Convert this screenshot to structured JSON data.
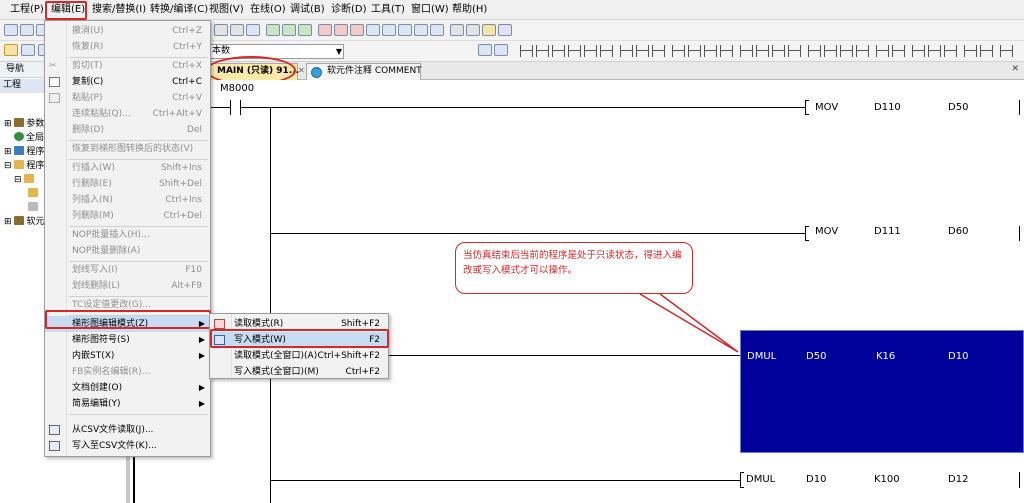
{
  "menubar": {
    "items": [
      "工程(P)",
      "编辑(E)",
      "搜索/替换(I)",
      "转换/编译(C)",
      "视图(V)",
      "在线(O)",
      "调试(B)",
      "诊断(D)",
      "工具(T)",
      "窗口(W)",
      "帮助(H)"
    ],
    "highlighted": "编辑(E)"
  },
  "toolbar": {
    "combo_text": "本数"
  },
  "nav": {
    "title": "导航",
    "subtitle": "工程",
    "tree": [
      "参数",
      "全局",
      "程序",
      "程序",
      "软元"
    ]
  },
  "tabs": {
    "main_label": "MAIN (只读) 91...",
    "comment_label": "软元件注释 COMMENT"
  },
  "ladder": {
    "contact": "M8000",
    "rows": [
      {
        "instr": "MOV",
        "op1": "D110",
        "op2": "D50",
        "selected": false
      },
      {
        "instr": "MOV",
        "op1": "D111",
        "op2": "D60",
        "selected": false
      },
      {
        "instr": "DMUL",
        "op1": "D50",
        "op2": "K16",
        "op3": "D10",
        "selected": true
      },
      {
        "instr": "DMUL",
        "op1": "D10",
        "op2": "K100",
        "op3": "D12",
        "selected": false
      }
    ]
  },
  "callout": {
    "text": "当仿真结束后当前的程序是处于只读状态，得进入编改或写入模式才可以操作。"
  },
  "edit_menu": {
    "items": [
      {
        "label": "撤消(U)",
        "shortcut": "Ctrl+Z",
        "disabled": true
      },
      {
        "label": "恢复(R)",
        "shortcut": "Ctrl+Y",
        "disabled": true
      },
      {
        "label": "剪切(T)",
        "shortcut": "Ctrl+X",
        "disabled": true
      },
      {
        "label": "复制(C)",
        "shortcut": "Ctrl+C",
        "disabled": false
      },
      {
        "label": "粘贴(P)",
        "shortcut": "Ctrl+V",
        "disabled": true
      },
      {
        "label": "连续粘贴(Q)...",
        "shortcut": "Ctrl+Alt+V",
        "disabled": true
      },
      {
        "label": "删除(D)",
        "shortcut": "Del",
        "disabled": true
      },
      {
        "label": "恢复到梯形图转换后的状态(V)",
        "shortcut": "",
        "disabled": true
      },
      {
        "label": "行插入(W)",
        "shortcut": "Shift+Ins",
        "disabled": true
      },
      {
        "label": "行删除(E)",
        "shortcut": "Shift+Del",
        "disabled": true
      },
      {
        "label": "列插入(N)",
        "shortcut": "Ctrl+Ins",
        "disabled": true
      },
      {
        "label": "列删除(M)",
        "shortcut": "Ctrl+Del",
        "disabled": true
      },
      {
        "label": "NOP批量插入(H)...",
        "shortcut": "",
        "disabled": true
      },
      {
        "label": "NOP批量删除(A)",
        "shortcut": "",
        "disabled": true
      },
      {
        "label": "划线写入(I)",
        "shortcut": "F10",
        "disabled": true
      },
      {
        "label": "划线删除(L)",
        "shortcut": "Alt+F9",
        "disabled": true
      },
      {
        "label": "TC设定值更改(G)...",
        "shortcut": "",
        "disabled": true
      },
      {
        "label": "梯形图编辑模式(Z)",
        "shortcut": "",
        "disabled": false,
        "submenu": true,
        "highlighted": true
      },
      {
        "label": "梯形图符号(S)",
        "shortcut": "",
        "disabled": false,
        "submenu": true
      },
      {
        "label": "内嵌ST(X)",
        "shortcut": "",
        "disabled": false,
        "submenu": true
      },
      {
        "label": "FB实例名编辑(R)...",
        "shortcut": "",
        "disabled": true
      },
      {
        "label": "文档创建(O)",
        "shortcut": "",
        "disabled": false,
        "submenu": true
      },
      {
        "label": "简易编辑(Y)",
        "shortcut": "",
        "disabled": false,
        "submenu": true
      },
      {
        "label": "从CSV文件读取(J)...",
        "shortcut": "",
        "disabled": false
      },
      {
        "label": "写入至CSV文件(K)...",
        "shortcut": "",
        "disabled": false
      }
    ]
  },
  "sub_menu": {
    "items": [
      {
        "label": "读取模式(R)",
        "shortcut": "Shift+F2",
        "highlighted": false
      },
      {
        "label": "写入模式(W)",
        "shortcut": "F2",
        "highlighted": true
      },
      {
        "label": "读取模式(全窗口)(A)",
        "shortcut": "Ctrl+Shift+F2",
        "highlighted": false
      },
      {
        "label": "写入模式(全窗口)(M)",
        "shortcut": "Ctrl+F2",
        "highlighted": false
      }
    ]
  },
  "colors": {
    "annotation_red": "#d62828",
    "selection_blue": "#00009a",
    "menu_highlight": "#c7dcf3"
  }
}
